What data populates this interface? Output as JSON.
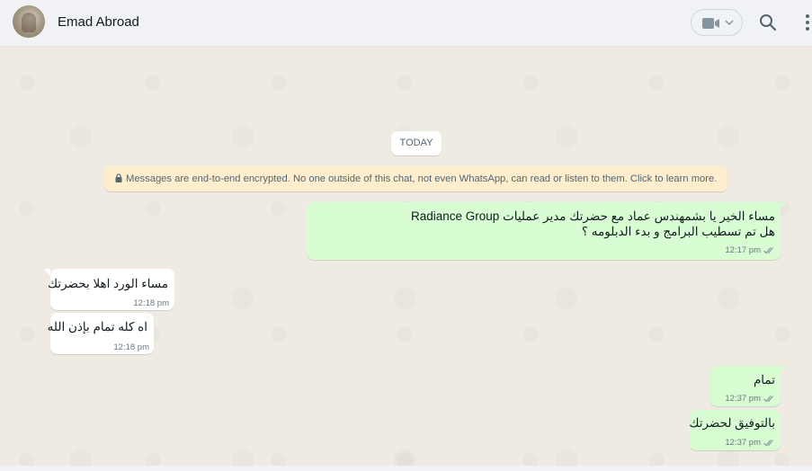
{
  "header": {
    "contact_name": "Emad Abroad",
    "icons": [
      "avatar",
      "video-call-icon",
      "chevron-down-icon",
      "search-icon",
      "menu-icon"
    ]
  },
  "chat": {
    "date_label": "TODAY",
    "encryption_notice": "Messages are end-to-end encrypted. No one outside of this chat, not even WhatsApp, can read or listen to them. Click to learn more.",
    "messages": [
      {
        "direction": "outgoing",
        "lines": [
          "مساء الخير يا بشمهندس عماد مع حضرتك  مدير عمليات Radiance Group",
          "هل تم تسطيب البرامج و بدء الدبلومه ؟"
        ],
        "time": "12:17 pm",
        "status": "read"
      },
      {
        "direction": "incoming",
        "lines": [
          "مساء الورد اهلا بحضرتك"
        ],
        "time": "12:18 pm"
      },
      {
        "direction": "incoming",
        "lines": [
          "اه كله تمام بإذن الله"
        ],
        "time": "12:18 pm"
      },
      {
        "direction": "outgoing",
        "lines": [
          "تمام"
        ],
        "time": "12:37 pm",
        "status": "read"
      },
      {
        "direction": "outgoing",
        "lines": [
          "بالتوفيق لحضرتك"
        ],
        "time": "12:37 pm",
        "status": "read"
      }
    ]
  },
  "colors": {
    "header_bg": "#f0f2f5",
    "chat_bg": "#efeae2",
    "outgoing_bubble": "#d9fdd3",
    "incoming_bubble": "#ffffff",
    "encryption_bg": "#ffeecd",
    "read_ticks": "#8696a0"
  }
}
